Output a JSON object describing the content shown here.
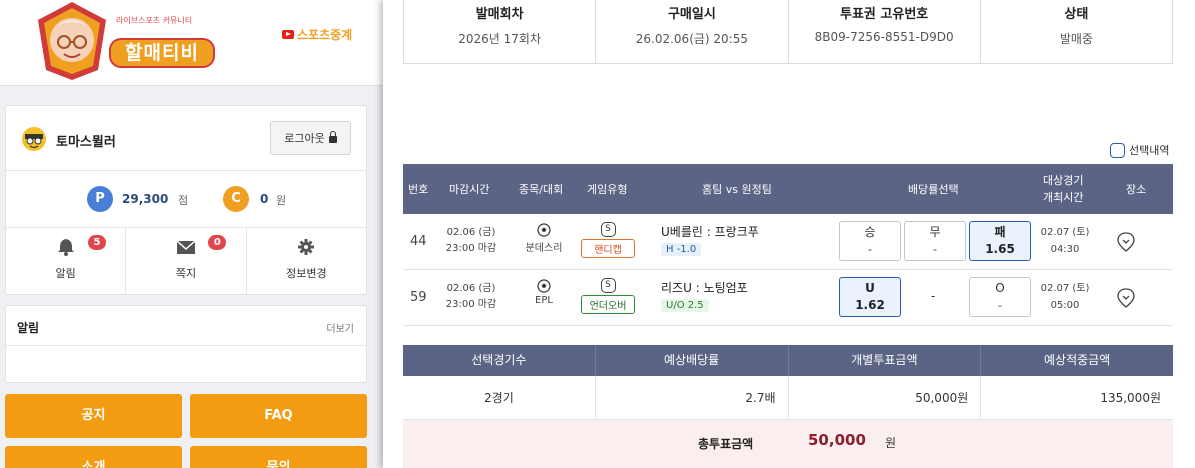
{
  "header": {
    "logo_sub": "라이브스포츠 커뮤니티",
    "logo_main": "할매티비",
    "sports_link": "스포츠중계"
  },
  "user": {
    "name": "토마스뮐러",
    "logout_label": "로그아웃",
    "points": "29,300",
    "points_unit": "점",
    "points_icon": "P",
    "cash": "0",
    "cash_unit": "원",
    "cash_icon": "C"
  },
  "quick": [
    {
      "label": "알림",
      "count": "5",
      "icon": "bell-icon"
    },
    {
      "label": "쪽지",
      "count": "0",
      "icon": "envelope-icon"
    },
    {
      "label": "정보변경",
      "icon": "gear-icon"
    }
  ],
  "notice": {
    "title": "알림",
    "more": "더보기"
  },
  "menu_buttons": [
    "공지",
    "FAQ",
    "소개",
    "문의"
  ],
  "info": {
    "headers": [
      "발매회차",
      "구매일시",
      "투표권 고유번호",
      "상태"
    ],
    "values": [
      "2026년 17회차",
      "26.02.06(금) 20:55",
      "8B09-7256-8551-D9D0",
      "발매중"
    ]
  },
  "select_toggle": "선택내역",
  "bet_table": {
    "headers": [
      "번호",
      "마감시간",
      "종목/대회",
      "게임유형",
      "홈팀 vs 원정팀",
      "배당률선택",
      "대상경기\n개최시간",
      "장소"
    ],
    "rows": [
      {
        "num": "44",
        "deadline_date": "02.06 (금)",
        "deadline_time": "23:00 마감",
        "league": "분데스리",
        "s_mark": "S",
        "type": "핸디캡",
        "match": "U베를린 : 프랑크푸",
        "sub": "H -1.0",
        "odds": [
          {
            "label": "승",
            "value": "-",
            "selected": false
          },
          {
            "label": "무",
            "value": "-",
            "selected": false
          },
          {
            "label": "패",
            "value": "1.65",
            "selected": true
          }
        ],
        "game_date": "02.07 (토)",
        "game_time": "04:30"
      },
      {
        "num": "59",
        "deadline_date": "02.06 (금)",
        "deadline_time": "23:00 마감",
        "league": "EPL",
        "s_mark": "S",
        "type": "언더오버",
        "match": "리즈U : 노팅엄포",
        "sub": "U/O 2.5",
        "odds": [
          {
            "label": "U",
            "value": "1.62",
            "selected": true
          },
          {
            "label": "-",
            "value": "",
            "selected": false
          },
          {
            "label": "O",
            "value": "-",
            "selected": false
          }
        ],
        "game_date": "02.07 (토)",
        "game_time": "05:00"
      }
    ]
  },
  "summary": {
    "headers": [
      "선택경기수",
      "예상배당률",
      "개별투표금액",
      "예상적중금액"
    ],
    "values": [
      "2경기",
      "2.7배",
      "50,000원",
      "135,000원"
    ]
  },
  "total": {
    "label": "총투표금액",
    "value": "50,000",
    "unit": "원"
  },
  "colors": {
    "accent": "#f39c12",
    "table_header": "#5b6485",
    "selected_border": "#2a5db0",
    "total_value": "#8a1f2e"
  }
}
